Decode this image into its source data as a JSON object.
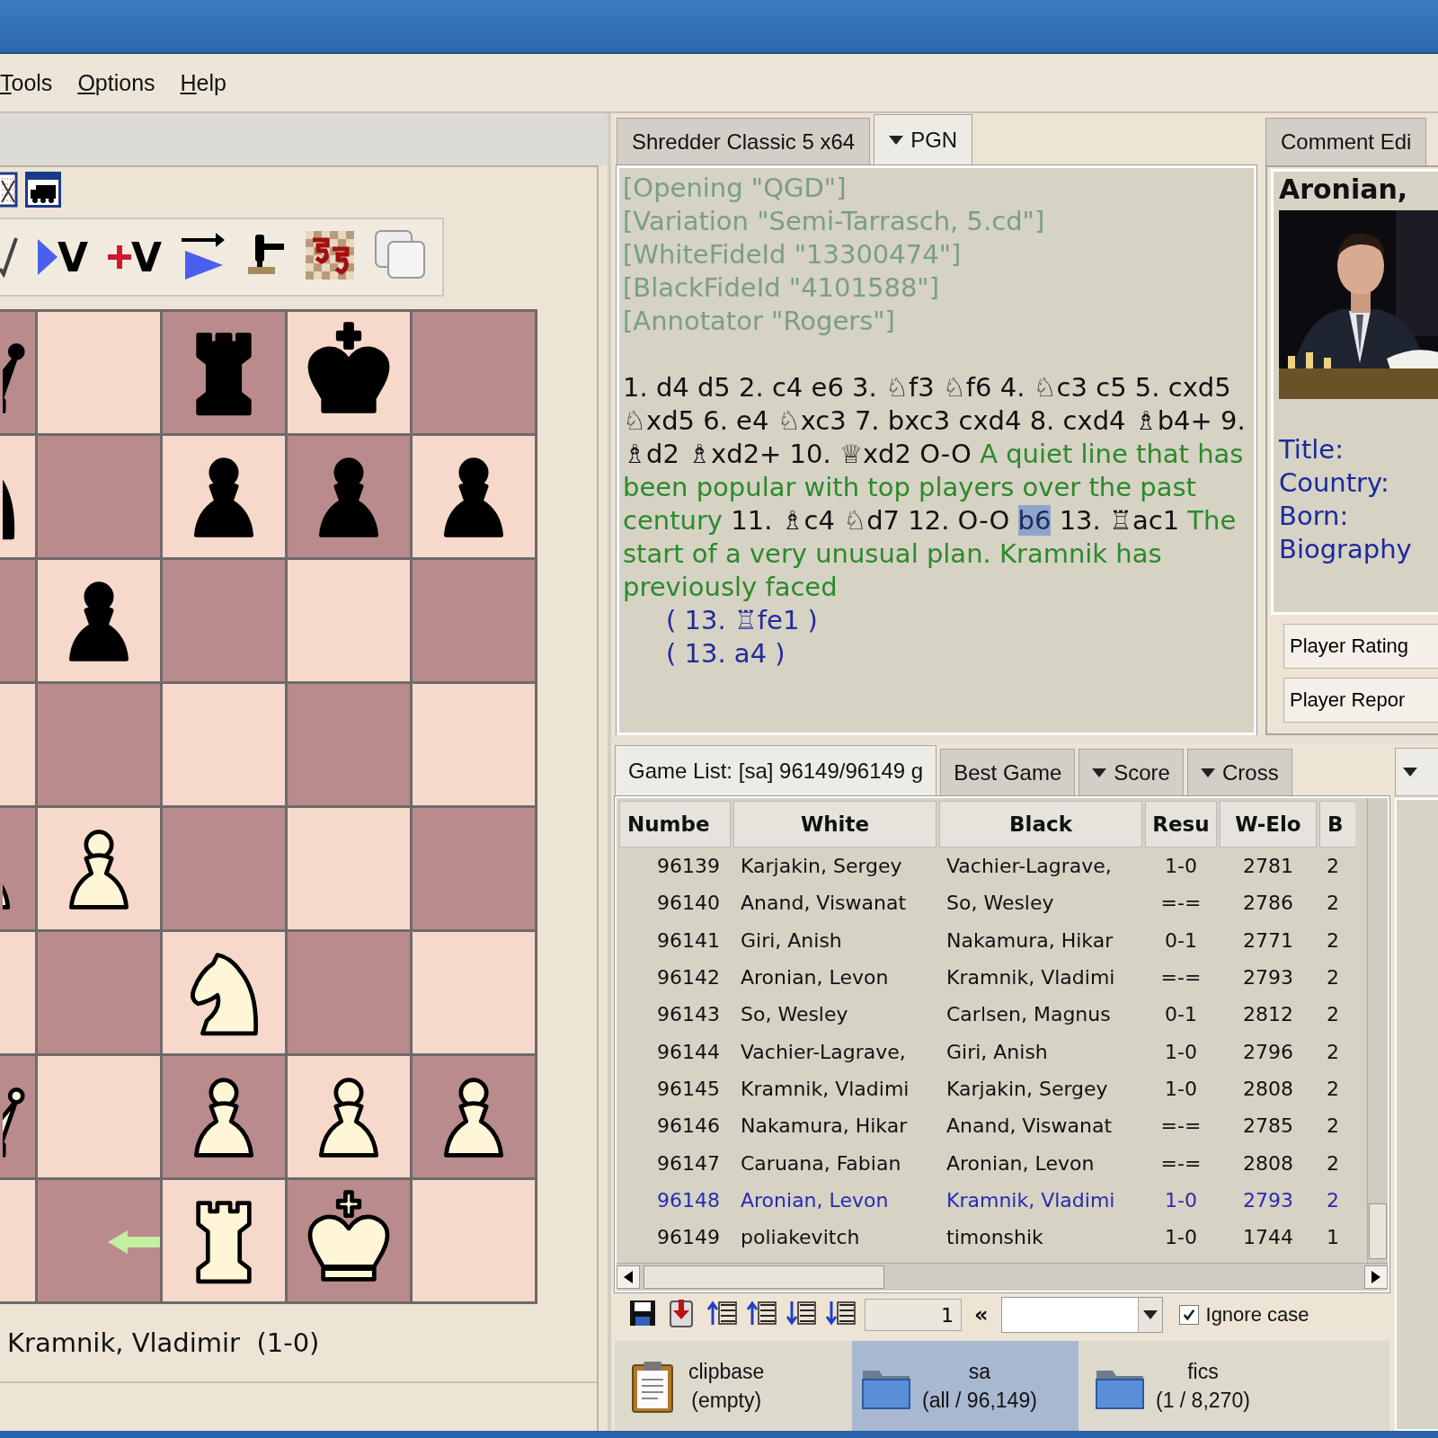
{
  "menu": [
    {
      "label": "Tools"
    },
    {
      "label": "Options"
    },
    {
      "label": "Help"
    }
  ],
  "board_panel": {
    "toolbar_top": [
      {
        "kind": "grid"
      },
      {
        "kind": "train"
      }
    ],
    "toolbar": [
      {
        "kind": "check"
      },
      {
        "kind": "play-variation",
        "label": "V"
      },
      {
        "kind": "add-variation",
        "label": "V"
      },
      {
        "kind": "forward"
      },
      {
        "kind": "gavel"
      },
      {
        "kind": "swirl"
      },
      {
        "kind": "copy"
      }
    ],
    "ranks": [
      [
        {
          "kind": "queen",
          "black": true,
          "arrow": false
        },
        {
          "kind": "empty",
          "arrow": false
        },
        {
          "kind": "rook",
          "black": true,
          "arrow": false
        },
        {
          "kind": "king",
          "black": true,
          "arrow": false
        },
        {
          "kind": "empty",
          "arrow": false
        }
      ],
      [
        {
          "kind": "knight",
          "black": true,
          "arrow": false
        },
        {
          "kind": "empty",
          "arrow": false
        },
        {
          "kind": "pawn",
          "black": true,
          "arrow": false
        },
        {
          "kind": "pawn",
          "black": true,
          "arrow": false
        },
        {
          "kind": "pawn",
          "black": true,
          "arrow": false
        }
      ],
      [
        {
          "kind": "empty",
          "arrow": false
        },
        {
          "kind": "pawn",
          "black": true,
          "arrow": false
        },
        {
          "kind": "empty",
          "arrow": false
        },
        {
          "kind": "empty",
          "arrow": false
        },
        {
          "kind": "empty",
          "arrow": false
        }
      ],
      [
        {
          "kind": "empty",
          "arrow": false
        },
        {
          "kind": "empty",
          "arrow": false
        },
        {
          "kind": "empty",
          "arrow": false
        },
        {
          "kind": "empty",
          "arrow": false
        },
        {
          "kind": "empty",
          "arrow": false
        }
      ],
      [
        {
          "kind": "pawn",
          "black": false,
          "arrow": false
        },
        {
          "kind": "pawn",
          "black": false,
          "arrow": false
        },
        {
          "kind": "empty",
          "arrow": false
        },
        {
          "kind": "empty",
          "arrow": false
        },
        {
          "kind": "empty",
          "arrow": false
        }
      ],
      [
        {
          "kind": "empty",
          "arrow": false
        },
        {
          "kind": "empty",
          "arrow": false
        },
        {
          "kind": "knight",
          "black": false,
          "arrow": false
        },
        {
          "kind": "empty",
          "arrow": false
        },
        {
          "kind": "empty",
          "arrow": false
        }
      ],
      [
        {
          "kind": "queen",
          "black": false,
          "arrow": false
        },
        {
          "kind": "empty",
          "arrow": false
        },
        {
          "kind": "pawn",
          "black": false,
          "arrow": false
        },
        {
          "kind": "pawn",
          "black": false,
          "arrow": false
        },
        {
          "kind": "pawn",
          "black": false,
          "arrow": false
        }
      ],
      [
        {
          "kind": "empty",
          "arrow": false
        },
        {
          "kind": "empty",
          "arrow": true
        },
        {
          "kind": "rook",
          "black": false,
          "arrow": false
        },
        {
          "kind": "king",
          "black": false,
          "arrow": false
        },
        {
          "kind": "empty",
          "arrow": false
        }
      ]
    ],
    "result_line": "Kramnik, Vladimir  (1-0)"
  },
  "pgn": {
    "tabs": [
      {
        "label": "Shredder Classic 5 x64",
        "selected": false,
        "dropdown": false
      },
      {
        "label": "PGN",
        "selected": true,
        "dropdown": true
      }
    ],
    "headers": [
      "[Opening \"QGD\"]",
      "[Variation \"Semi-Tarrasch, 5.cd\"]",
      "[WhiteFideId \"13300474\"]",
      "[BlackFideId \"4101588\"]",
      "[Annotator \"Rogers\"]"
    ],
    "segments": [
      {
        "kind": "moves",
        "text": "1. d4 d5 2. c4 e6 3. ♘f3 ♘f6 4. ♘c3 c5 5. cxd5 ♘xd5 6. e4 ♘xc3 7. bxc3 cxd4 8. cxd4 ♗b4+ 9. ♗d2 ♗xd2+ 10. ♕xd2 O-O"
      },
      {
        "kind": "comment",
        "text": "A quiet line that has been popular with top players over the past century"
      },
      {
        "kind": "moves",
        "text": "11. ♗c4 ♘d7 12. O-O"
      },
      {
        "kind": "current",
        "text": "b6"
      },
      {
        "kind": "moves",
        "text": "13. ♖ac1"
      },
      {
        "kind": "comment",
        "text": "The start of a very unusual plan. Kramnik has previously faced"
      }
    ],
    "variations": [
      "( 13. ♖fe1 )",
      "( 13. a4 )"
    ]
  },
  "player_panel": {
    "tab": "Comment Edi",
    "name": "Aronian,",
    "photo": {
      "kind": "picture"
    },
    "labels": [
      "Title:",
      "Country:",
      "Born:",
      "Biography"
    ],
    "buttons": [
      "Player Rating",
      "Player Repor"
    ]
  },
  "game_list": {
    "tabs": [
      {
        "label": "Game List: [sa] 96149/96149 g",
        "selected": true,
        "dropdown": false
      },
      {
        "label": "Best Game",
        "selected": false,
        "dropdown": false
      },
      {
        "label": "Score",
        "selected": false,
        "dropdown": true
      },
      {
        "label": "Cross",
        "selected": false,
        "dropdown": true
      }
    ],
    "columns": [
      "Numbe",
      "White",
      "Black",
      "Resu",
      "W-Elo",
      "B"
    ],
    "rows": [
      {
        "cells": [
          "96139",
          "Karjakin, Sergey",
          "Vachier-Lagrave,",
          "1-0",
          "2781",
          "2"
        ],
        "current": false
      },
      {
        "cells": [
          "96140",
          "Anand, Viswanat",
          "So, Wesley",
          "=-=",
          "2786",
          "2"
        ],
        "current": false
      },
      {
        "cells": [
          "96141",
          "Giri, Anish",
          "Nakamura, Hikar",
          "0-1",
          "2771",
          "2"
        ],
        "current": false
      },
      {
        "cells": [
          "96142",
          "Aronian, Levon",
          "Kramnik, Vladimi",
          "=-=",
          "2793",
          "2"
        ],
        "current": false
      },
      {
        "cells": [
          "96143",
          "So, Wesley",
          "Carlsen, Magnus",
          "0-1",
          "2812",
          "2"
        ],
        "current": false
      },
      {
        "cells": [
          "96144",
          "Vachier-Lagrave,",
          "Giri, Anish",
          "1-0",
          "2796",
          "2"
        ],
        "current": false
      },
      {
        "cells": [
          "96145",
          "Kramnik, Vladimi",
          "Karjakin, Sergey",
          "1-0",
          "2808",
          "2"
        ],
        "current": false
      },
      {
        "cells": [
          "96146",
          "Nakamura, Hikar",
          "Anand, Viswanat",
          "=-=",
          "2785",
          "2"
        ],
        "current": false
      },
      {
        "cells": [
          "96147",
          "Caruana, Fabian",
          "Aronian, Levon",
          "=-=",
          "2808",
          "2"
        ],
        "current": false
      },
      {
        "cells": [
          "96148",
          "Aronian, Levon",
          "Kramnik, Vladimi",
          "1-0",
          "2793",
          "2"
        ],
        "current": true
      },
      {
        "cells": [
          "96149",
          "poliakevitch",
          "timonshik",
          "1-0",
          "1744",
          "1"
        ],
        "current": false
      }
    ],
    "toolbar": [
      {
        "kind": "save"
      },
      {
        "kind": "import"
      },
      {
        "kind": "list-up"
      },
      {
        "kind": "list-up"
      },
      {
        "kind": "list-down"
      },
      {
        "kind": "list-down"
      }
    ],
    "game_number": "1",
    "back_label": "«",
    "ignore_case": {
      "label": "Ignore case",
      "checked": true
    }
  },
  "bases": [
    {
      "kind": "clipboard",
      "name": "clipbase",
      "count": "(empty)",
      "selected": false
    },
    {
      "kind": "folder",
      "name": "sa",
      "count": "(all / 96,149)",
      "selected": true
    },
    {
      "kind": "folder",
      "name": "fics",
      "count": "(1 / 8,270)",
      "selected": false
    }
  ]
}
